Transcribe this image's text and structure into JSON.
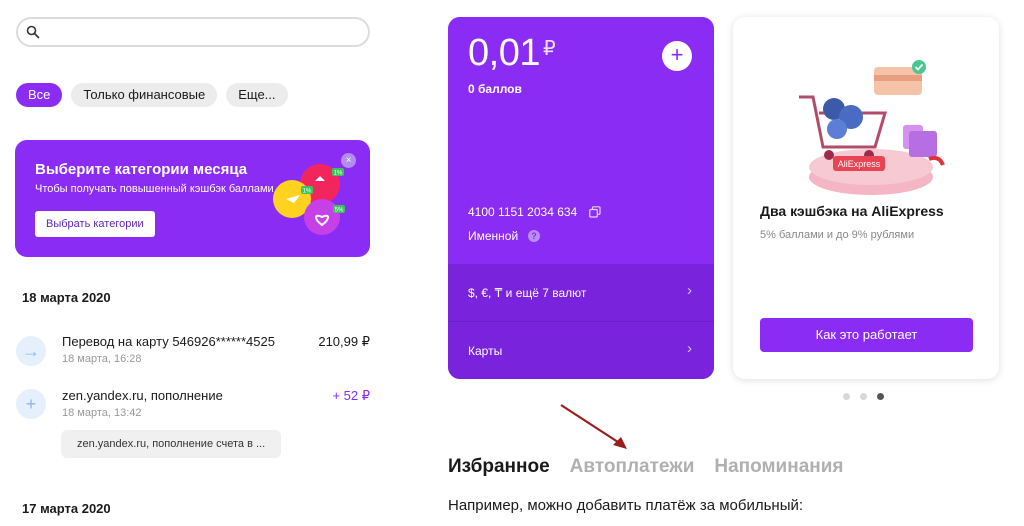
{
  "search": {
    "placeholder": "",
    "icon": "search-icon"
  },
  "filters": [
    "Все",
    "Только финансовые",
    "Еще..."
  ],
  "promo": {
    "title": "Выберите категории месяца",
    "subtitle": "Чтобы получать повышенный кэшбэк баллами",
    "button": "Выбрать категории",
    "close": "×",
    "badges": [
      "1%",
      "1%",
      "5%"
    ]
  },
  "feed": {
    "dates": [
      "18 марта 2020",
      "17 марта 2020"
    ],
    "transactions": [
      {
        "title": "Перевод на карту 546926******4525",
        "subtitle": "18 марта, 16:28",
        "amount": "210,99 ₽",
        "icon": "arrow-right-icon",
        "glyph": "→"
      },
      {
        "title": "zen.yandex.ru, пополнение",
        "subtitle": "18 марта, 13:42",
        "amount": "+ 52 ₽",
        "icon": "plus-icon",
        "glyph": "+"
      }
    ],
    "note": "zen.yandex.ru, пополнение счета в ..."
  },
  "wallet": {
    "balance": "0,01",
    "currency": "₽",
    "points": "0 баллов",
    "add": "+",
    "card_number": "4100 1151 2034 634",
    "named": "Именной",
    "info": "?",
    "rows": [
      {
        "label": "$, €, ₸ и ещё 7 валют",
        "chevron": "›"
      },
      {
        "label": "Карты",
        "chevron": "›"
      }
    ]
  },
  "aliexpress": {
    "logo": "AliExpress",
    "title": "Два кэшбэка на AliExpress",
    "subtitle": "5% баллами и до 9% рублями",
    "button": "Как это работает"
  },
  "carousel": {
    "count": 3,
    "active": 3
  },
  "tabs": [
    "Избранное",
    "Автоплатежи",
    "Напоминания"
  ],
  "hint": "Например, можно добавить платёж за мобильный:",
  "colors": {
    "accent": "#8b2cf5",
    "accent_dark": "#7a23dc",
    "annotation_arrow": "#9b1c1c"
  }
}
